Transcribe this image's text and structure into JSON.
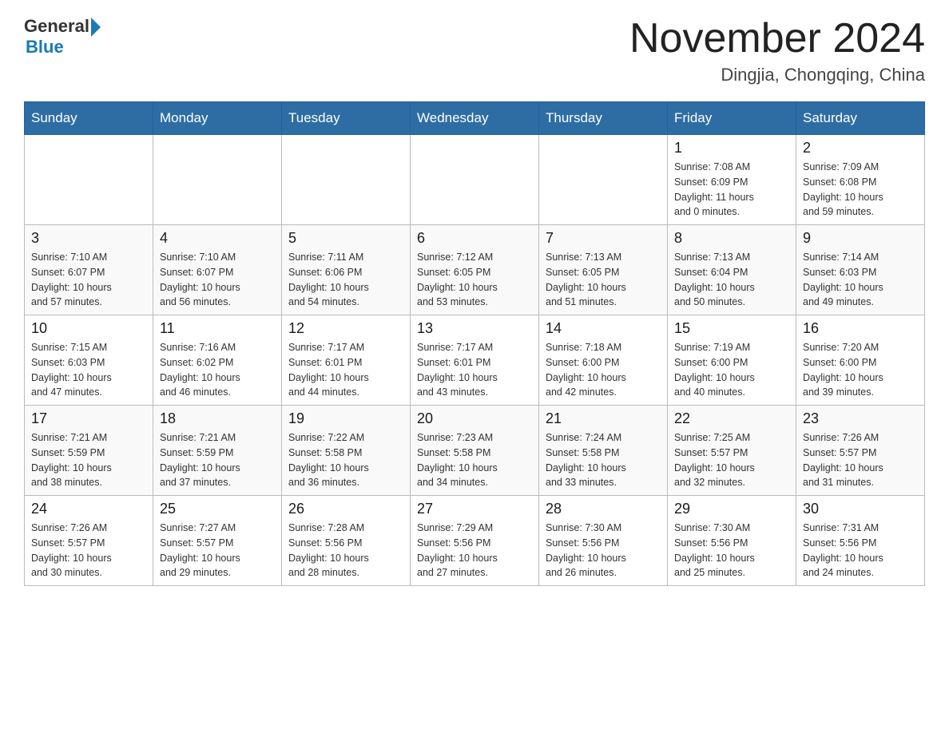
{
  "header": {
    "logo_general": "General",
    "logo_blue": "Blue",
    "month_title": "November 2024",
    "subtitle": "Dingjia, Chongqing, China"
  },
  "weekdays": [
    "Sunday",
    "Monday",
    "Tuesday",
    "Wednesday",
    "Thursday",
    "Friday",
    "Saturday"
  ],
  "weeks": [
    [
      {
        "day": "",
        "info": ""
      },
      {
        "day": "",
        "info": ""
      },
      {
        "day": "",
        "info": ""
      },
      {
        "day": "",
        "info": ""
      },
      {
        "day": "",
        "info": ""
      },
      {
        "day": "1",
        "info": "Sunrise: 7:08 AM\nSunset: 6:09 PM\nDaylight: 11 hours\nand 0 minutes."
      },
      {
        "day": "2",
        "info": "Sunrise: 7:09 AM\nSunset: 6:08 PM\nDaylight: 10 hours\nand 59 minutes."
      }
    ],
    [
      {
        "day": "3",
        "info": "Sunrise: 7:10 AM\nSunset: 6:07 PM\nDaylight: 10 hours\nand 57 minutes."
      },
      {
        "day": "4",
        "info": "Sunrise: 7:10 AM\nSunset: 6:07 PM\nDaylight: 10 hours\nand 56 minutes."
      },
      {
        "day": "5",
        "info": "Sunrise: 7:11 AM\nSunset: 6:06 PM\nDaylight: 10 hours\nand 54 minutes."
      },
      {
        "day": "6",
        "info": "Sunrise: 7:12 AM\nSunset: 6:05 PM\nDaylight: 10 hours\nand 53 minutes."
      },
      {
        "day": "7",
        "info": "Sunrise: 7:13 AM\nSunset: 6:05 PM\nDaylight: 10 hours\nand 51 minutes."
      },
      {
        "day": "8",
        "info": "Sunrise: 7:13 AM\nSunset: 6:04 PM\nDaylight: 10 hours\nand 50 minutes."
      },
      {
        "day": "9",
        "info": "Sunrise: 7:14 AM\nSunset: 6:03 PM\nDaylight: 10 hours\nand 49 minutes."
      }
    ],
    [
      {
        "day": "10",
        "info": "Sunrise: 7:15 AM\nSunset: 6:03 PM\nDaylight: 10 hours\nand 47 minutes."
      },
      {
        "day": "11",
        "info": "Sunrise: 7:16 AM\nSunset: 6:02 PM\nDaylight: 10 hours\nand 46 minutes."
      },
      {
        "day": "12",
        "info": "Sunrise: 7:17 AM\nSunset: 6:01 PM\nDaylight: 10 hours\nand 44 minutes."
      },
      {
        "day": "13",
        "info": "Sunrise: 7:17 AM\nSunset: 6:01 PM\nDaylight: 10 hours\nand 43 minutes."
      },
      {
        "day": "14",
        "info": "Sunrise: 7:18 AM\nSunset: 6:00 PM\nDaylight: 10 hours\nand 42 minutes."
      },
      {
        "day": "15",
        "info": "Sunrise: 7:19 AM\nSunset: 6:00 PM\nDaylight: 10 hours\nand 40 minutes."
      },
      {
        "day": "16",
        "info": "Sunrise: 7:20 AM\nSunset: 6:00 PM\nDaylight: 10 hours\nand 39 minutes."
      }
    ],
    [
      {
        "day": "17",
        "info": "Sunrise: 7:21 AM\nSunset: 5:59 PM\nDaylight: 10 hours\nand 38 minutes."
      },
      {
        "day": "18",
        "info": "Sunrise: 7:21 AM\nSunset: 5:59 PM\nDaylight: 10 hours\nand 37 minutes."
      },
      {
        "day": "19",
        "info": "Sunrise: 7:22 AM\nSunset: 5:58 PM\nDaylight: 10 hours\nand 36 minutes."
      },
      {
        "day": "20",
        "info": "Sunrise: 7:23 AM\nSunset: 5:58 PM\nDaylight: 10 hours\nand 34 minutes."
      },
      {
        "day": "21",
        "info": "Sunrise: 7:24 AM\nSunset: 5:58 PM\nDaylight: 10 hours\nand 33 minutes."
      },
      {
        "day": "22",
        "info": "Sunrise: 7:25 AM\nSunset: 5:57 PM\nDaylight: 10 hours\nand 32 minutes."
      },
      {
        "day": "23",
        "info": "Sunrise: 7:26 AM\nSunset: 5:57 PM\nDaylight: 10 hours\nand 31 minutes."
      }
    ],
    [
      {
        "day": "24",
        "info": "Sunrise: 7:26 AM\nSunset: 5:57 PM\nDaylight: 10 hours\nand 30 minutes."
      },
      {
        "day": "25",
        "info": "Sunrise: 7:27 AM\nSunset: 5:57 PM\nDaylight: 10 hours\nand 29 minutes."
      },
      {
        "day": "26",
        "info": "Sunrise: 7:28 AM\nSunset: 5:56 PM\nDaylight: 10 hours\nand 28 minutes."
      },
      {
        "day": "27",
        "info": "Sunrise: 7:29 AM\nSunset: 5:56 PM\nDaylight: 10 hours\nand 27 minutes."
      },
      {
        "day": "28",
        "info": "Sunrise: 7:30 AM\nSunset: 5:56 PM\nDaylight: 10 hours\nand 26 minutes."
      },
      {
        "day": "29",
        "info": "Sunrise: 7:30 AM\nSunset: 5:56 PM\nDaylight: 10 hours\nand 25 minutes."
      },
      {
        "day": "30",
        "info": "Sunrise: 7:31 AM\nSunset: 5:56 PM\nDaylight: 10 hours\nand 24 minutes."
      }
    ]
  ]
}
